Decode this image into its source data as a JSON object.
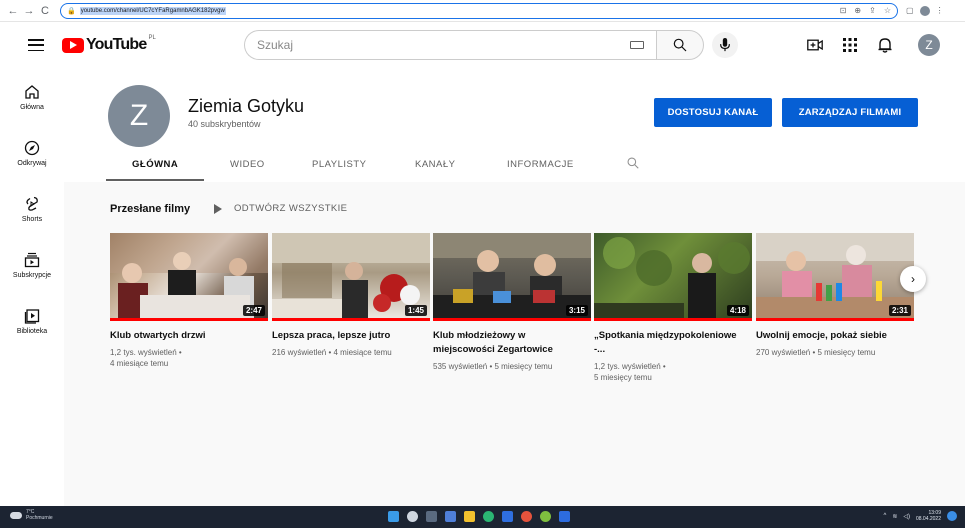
{
  "browser": {
    "url": "youtube.com/channel/UC7cYFaRgamnbAGK182pvgw"
  },
  "masthead": {
    "logo_text": "YouTube",
    "country_code": "PL",
    "search_placeholder": "Szukaj",
    "avatar_letter": "Z"
  },
  "sidebar": {
    "items": [
      {
        "label": "Główna"
      },
      {
        "label": "Odkrywaj"
      },
      {
        "label": "Shorts"
      },
      {
        "label": "Subskrypcje"
      },
      {
        "label": "Biblioteka"
      }
    ]
  },
  "channel": {
    "avatar_letter": "Z",
    "name": "Ziemia Gotyku",
    "subscribers": "40 subskrybentów",
    "customize_button": "DOSTOSUJ KANAŁ",
    "manage_button": "ZARZĄDZAJ FILMAMI"
  },
  "tabs": [
    {
      "label": "GŁÓWNA"
    },
    {
      "label": "WIDEO"
    },
    {
      "label": "PLAYLISTY"
    },
    {
      "label": "KANAŁY"
    },
    {
      "label": "INFORMACJE"
    }
  ],
  "section": {
    "title": "Przesłane filmy",
    "play_all": "ODTWÓRZ WSZYSTKIE"
  },
  "videos": [
    {
      "title": "Klub otwartych drzwi",
      "duration": "2:47",
      "meta1": "1,2 tys. wyświetleń •",
      "meta2": "4 miesiące temu"
    },
    {
      "title": "Lepsza praca, lepsze jutro",
      "duration": "1:45",
      "meta1": "216 wyświetleń • 4 miesiące temu",
      "meta2": ""
    },
    {
      "title": "Klub młodzieżowy w miejscowości Zegartowice",
      "duration": "3:15",
      "meta1": "535 wyświetleń • 5 miesięcy temu",
      "meta2": ""
    },
    {
      "title": "„Spotkania międzypokoleniowe -...",
      "duration": "4:18",
      "meta1": "1,2 tys. wyświetleń •",
      "meta2": "5 miesięcy temu"
    },
    {
      "title": "Uwolnij emocje, pokaż siebie",
      "duration": "2:31",
      "meta1": "270 wyświetleń • 5 miesięcy temu",
      "meta2": ""
    }
  ],
  "taskbar": {
    "temperature": "7°C",
    "weather": "Pochmurnie",
    "time": "13:09",
    "date": "08.04.2022"
  },
  "colors": {
    "brand_red": "#ff0000",
    "button_blue": "#065fd4",
    "avatar_gray": "#7e8a97"
  }
}
